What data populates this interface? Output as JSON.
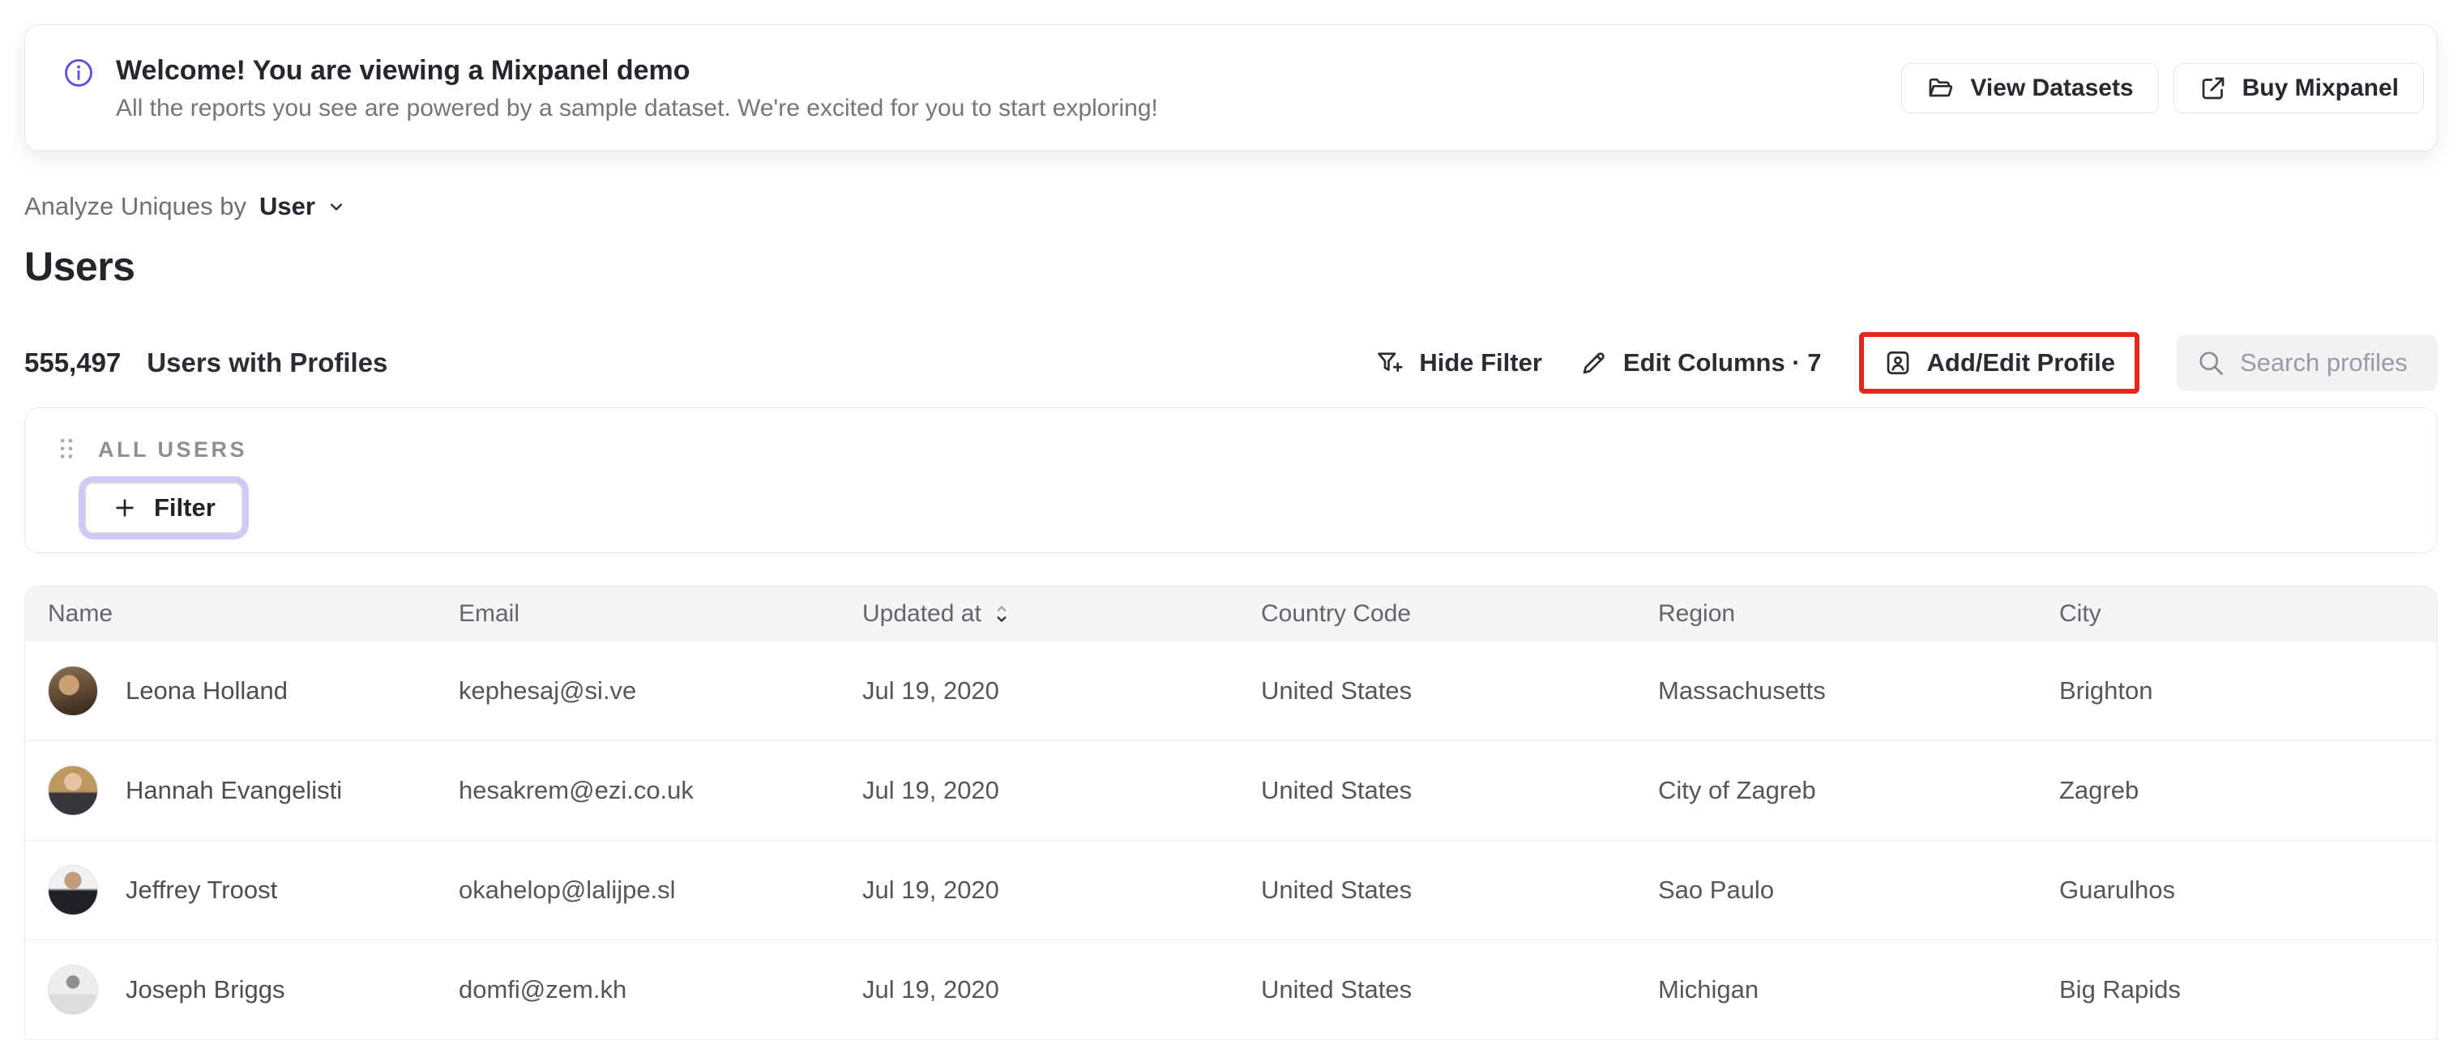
{
  "banner": {
    "title": "Welcome! You are viewing a Mixpanel demo",
    "subtitle": "All the reports you see are powered by a sample dataset. We're excited for you to start exploring!",
    "view_datasets_label": "View Datasets",
    "buy_mixpanel_label": "Buy Mixpanel"
  },
  "analyze_bar": {
    "label": "Analyze Uniques by",
    "selected": "User"
  },
  "page": {
    "title": "Users",
    "count": "555,497",
    "count_label": "Users with Profiles"
  },
  "toolbar": {
    "hide_filter_label": "Hide Filter",
    "edit_columns_label": "Edit Columns · 7",
    "add_edit_profile_label": "Add/Edit Profile",
    "search_placeholder": "Search profiles"
  },
  "filter_panel": {
    "group_label": "ALL USERS",
    "filter_button_label": "Filter"
  },
  "table": {
    "columns": [
      "Name",
      "Email",
      "Updated at",
      "Country Code",
      "Region",
      "City"
    ],
    "rows": [
      {
        "name": "Leona Holland",
        "email": "kephesaj@si.ve",
        "updated_at": "Jul 19, 2020",
        "country": "United States",
        "region": "Massachusetts",
        "city": "Brighton"
      },
      {
        "name": "Hannah Evangelisti",
        "email": "hesakrem@ezi.co.uk",
        "updated_at": "Jul 19, 2020",
        "country": "United States",
        "region": "City of Zagreb",
        "city": "Zagreb"
      },
      {
        "name": "Jeffrey Troost",
        "email": "okahelop@lalijpe.sl",
        "updated_at": "Jul 19, 2020",
        "country": "United States",
        "region": "Sao Paulo",
        "city": "Guarulhos"
      },
      {
        "name": "Joseph Briggs",
        "email": "domfi@zem.kh",
        "updated_at": "Jul 19, 2020",
        "country": "United States",
        "region": "Michigan",
        "city": "Big Rapids"
      }
    ]
  },
  "colors": {
    "accent_purple": "#5c4ce0",
    "filter_focus_ring": "#cfc9f7",
    "highlight_red": "#e0281c",
    "search_bg": "#f2f2f4",
    "table_header_bg": "#f5f5f6"
  }
}
